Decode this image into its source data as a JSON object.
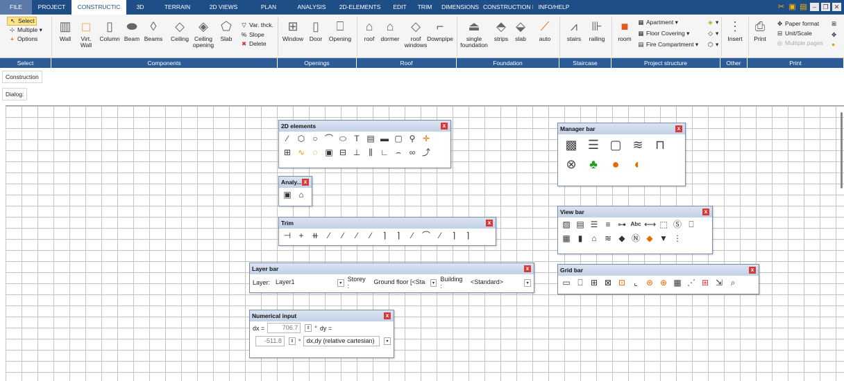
{
  "tabs": [
    "FILE",
    "PROJECT",
    "CONSTRUCTIC",
    "3D",
    "TERRAIN",
    "2D VIEWS",
    "PLAN",
    "ANALYSIS",
    "2D-ELEMENTS",
    "EDIT",
    "TRIM",
    "DIMENSIONS",
    "CONSTRUCTION EL",
    "INFO/HELP"
  ],
  "ribbon": {
    "select": "Select",
    "multiple": "Multiple",
    "options": "Options",
    "wall": "Wall",
    "virt_wall": "Virt. Wall",
    "column": "Column",
    "beam": "Beam",
    "beams": "Beams",
    "ceiling": "Ceiling",
    "ceiling_opening": "Ceiling opening",
    "slab": "Slab",
    "var_thck": "Var. thck.",
    "slope": "Slope",
    "delete": "Delete",
    "window": "Window",
    "door": "Door",
    "opening": "Opening",
    "roof": "roof",
    "dormer": "dormer",
    "roof_windows": "roof windows",
    "downpipe": "Downpipe",
    "single_foundation": "single foundation",
    "strips": "strips",
    "slab2": "slab",
    "auto": "auto",
    "stairs": "stairs",
    "railing": "railing",
    "room": "room",
    "apartment": "Apartment",
    "floor_covering": "Floor Covering",
    "fire_compartment": "Fire Compartment",
    "insert": "Insert",
    "print": "Print",
    "paper_format": "Paper format",
    "unit_scale": "Unit/Scale",
    "multiple_pages": "Multiple pages"
  },
  "groups": [
    "Select",
    "Components",
    "Openings",
    "Roof",
    "Foundation",
    "Staircase",
    "Project structure",
    "Other",
    "Print"
  ],
  "sidebar": {
    "construction": "Construction",
    "dialog": "Dialog:"
  },
  "palettes": {
    "elements2d": "2D elements",
    "analy": "Analy...",
    "trim": "Trim",
    "manager": "Manager bar",
    "view": "View bar",
    "grid": "Grid bar",
    "layer": "Layer bar",
    "numerical": "Numerical input"
  },
  "layer_bar": {
    "layer_label": "Layer:",
    "layer_value": "Layer1",
    "storey_label": "Storey :",
    "storey_value": "Ground floor [<Star",
    "building_label": "Building :",
    "building_value": "<Standard>"
  },
  "numerical_input": {
    "dx_label": "dx =",
    "dx_value": "706.7",
    "dy_label": "dy =",
    "dy_value": "-511.8",
    "mode": "dx,dy (relative cartesian)",
    "deg": "°"
  }
}
